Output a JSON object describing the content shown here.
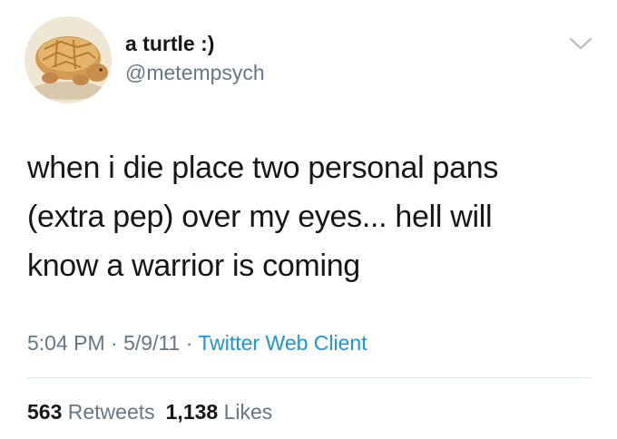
{
  "user": {
    "display_name": "a turtle :)",
    "handle": "@metempsych",
    "avatar_icon": "melon-pan-turtle-avatar"
  },
  "tweet": {
    "lines": [
      "when i die place two personal pans",
      "(extra pep) over my eyes... hell will",
      "know a warrior is coming"
    ],
    "time": "5:04 PM",
    "date": "5/9/11",
    "separator": "·",
    "client": "Twitter Web Client"
  },
  "stats": {
    "retweets_count": "563",
    "retweets_label": "Retweets",
    "likes_count": "1,138",
    "likes_label": "Likes"
  },
  "colors": {
    "text": "#14171a",
    "secondary": "#657786",
    "link": "#1b95e0",
    "divider": "#e1e8ed"
  }
}
